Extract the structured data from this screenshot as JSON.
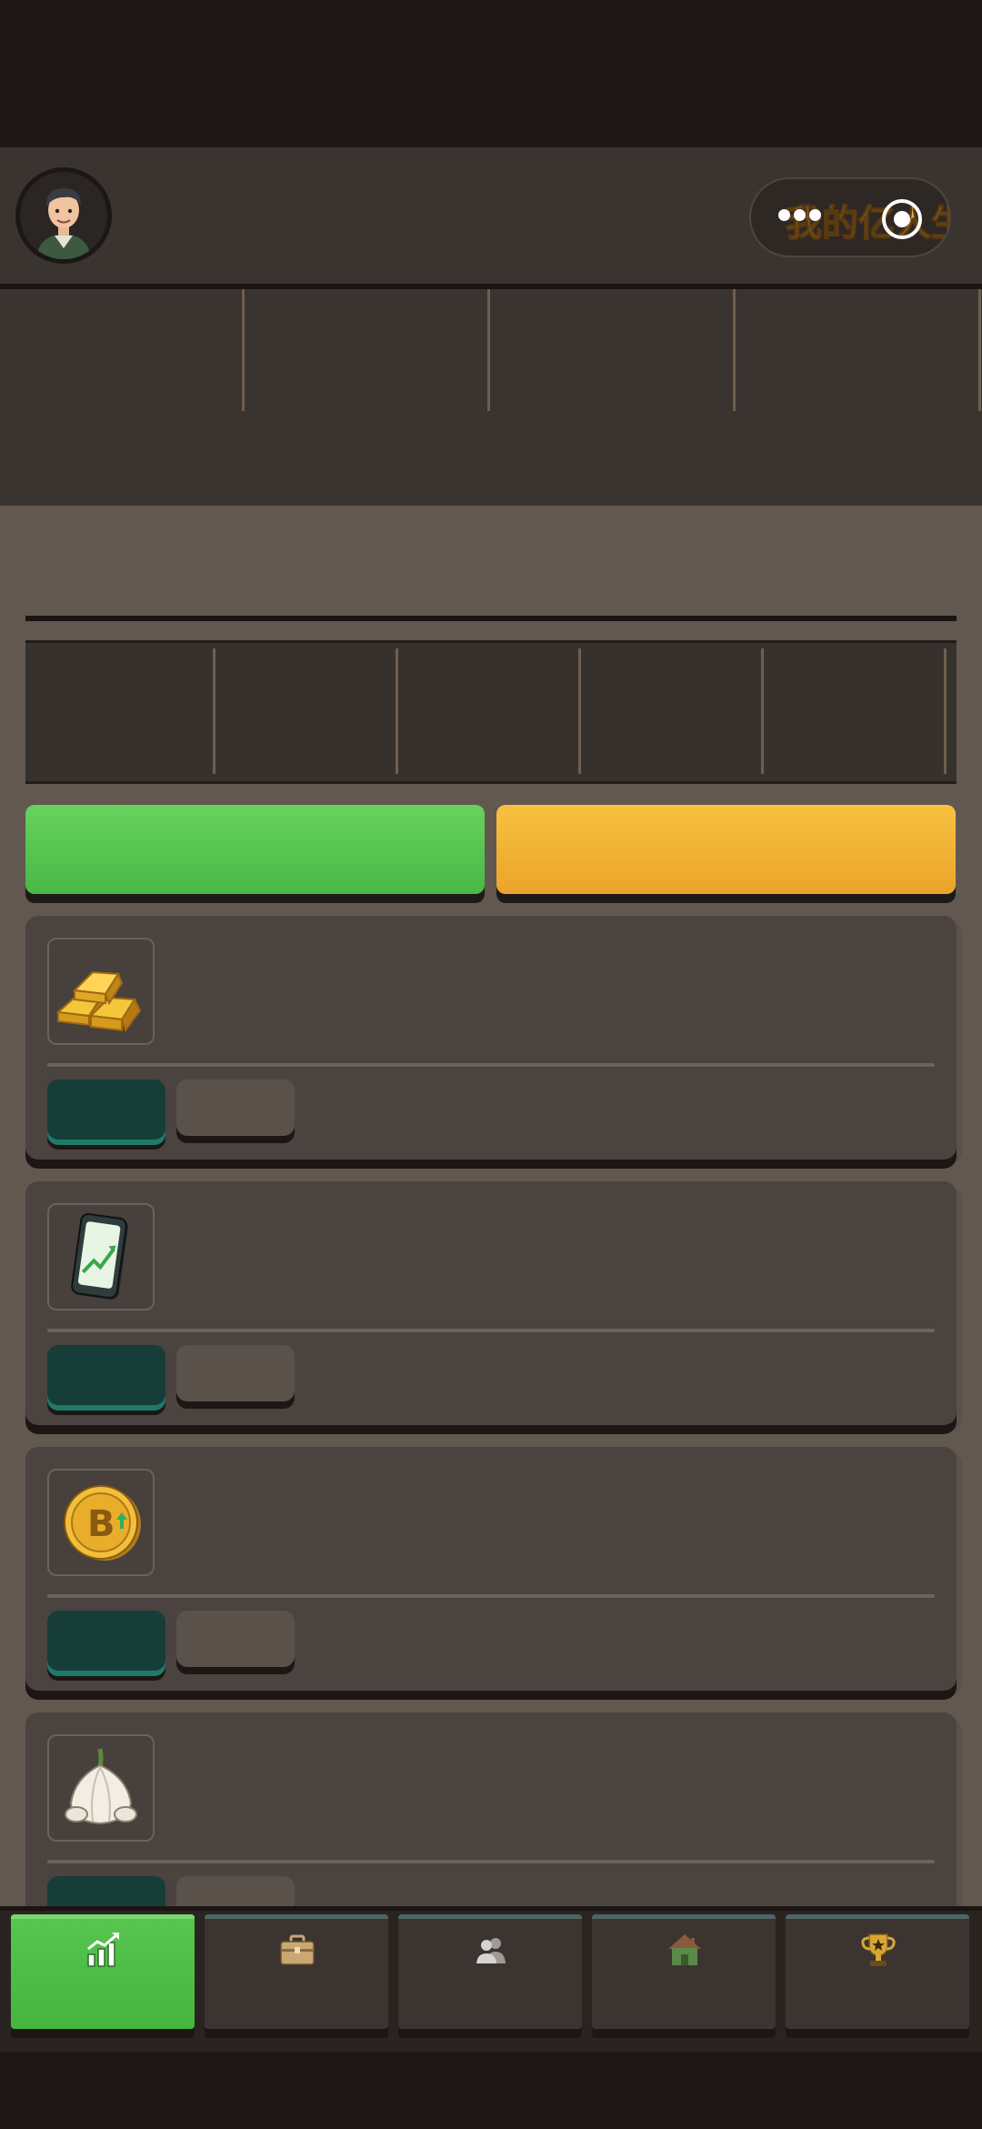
{
  "app": {
    "logo_text": "我的亿人生"
  },
  "header": {
    "avatar_icon": "player-avatar",
    "capsule_icons": [
      "more-dots-icon",
      "close-target-icon"
    ]
  },
  "stats": {
    "columns": [
      "",
      "",
      "",
      ""
    ]
  },
  "market": {
    "panel_cells": [
      "",
      "",
      "",
      "",
      ""
    ],
    "buttons": [
      {
        "label": "",
        "color": "#5acb52"
      },
      {
        "label": "",
        "color": "#f2b233"
      }
    ],
    "items": [
      {
        "icon": "gold-bars-icon",
        "buy_label": "",
        "sell_label": ""
      },
      {
        "icon": "stock-phone-icon",
        "buy_label": "",
        "sell_label": ""
      },
      {
        "icon": "bitcoin-icon",
        "buy_label": "",
        "sell_label": ""
      },
      {
        "icon": "garlic-icon",
        "buy_label": "",
        "sell_label": ""
      }
    ]
  },
  "nav": {
    "active_index": 0,
    "tabs": [
      {
        "icon": "market-chart-icon",
        "label": ""
      },
      {
        "icon": "briefcase-icon",
        "label": ""
      },
      {
        "icon": "people-icon",
        "label": ""
      },
      {
        "icon": "house-icon",
        "label": ""
      },
      {
        "icon": "trophy-icon",
        "label": ""
      }
    ]
  },
  "colors": {
    "accent_green": "#5acb52",
    "accent_yellow": "#f2b233",
    "teal_button": "#173d39",
    "card_bg": "#4b433f"
  }
}
